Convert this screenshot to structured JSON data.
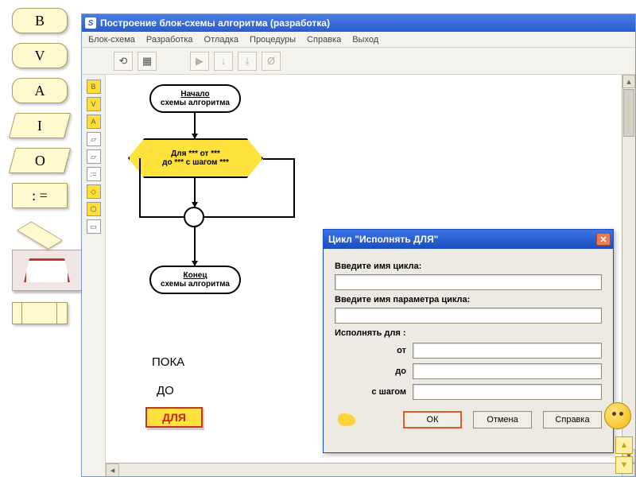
{
  "palette": {
    "b": "B",
    "v": "V",
    "a": "A",
    "i": "I",
    "o": "O",
    "assign": ": ="
  },
  "app": {
    "title": "Построение блок-схемы алгоритма (разработка)",
    "menu": [
      "Блок-схема",
      "Разработка",
      "Отладка",
      "Процедуры",
      "Справка",
      "Выход"
    ]
  },
  "flowchart": {
    "start_line1": "Начало",
    "start_line2": "схемы алгоритма",
    "loop_line1": "Для  ***  от  ***",
    "loop_line2": "до  ***  с шагом  ***",
    "end_line1": "Конец",
    "end_line2": "схемы алгоритма"
  },
  "labels": {
    "poka": "ПОКА",
    "do": "ДО",
    "dlya": "ДЛЯ"
  },
  "dialog": {
    "title": "Цикл \"Исполнять ДЛЯ\"",
    "f1": "Введите имя цикла:",
    "f2": "Введите имя параметра цикла:",
    "f3": "Исполнять для   :",
    "from": "от",
    "to": "до",
    "step": "с шагом",
    "ok": "ОК",
    "cancel": "Отмена",
    "help": "Справка",
    "v_name": "",
    "v_param": "",
    "v_from": "",
    "v_to": "",
    "v_step": ""
  }
}
